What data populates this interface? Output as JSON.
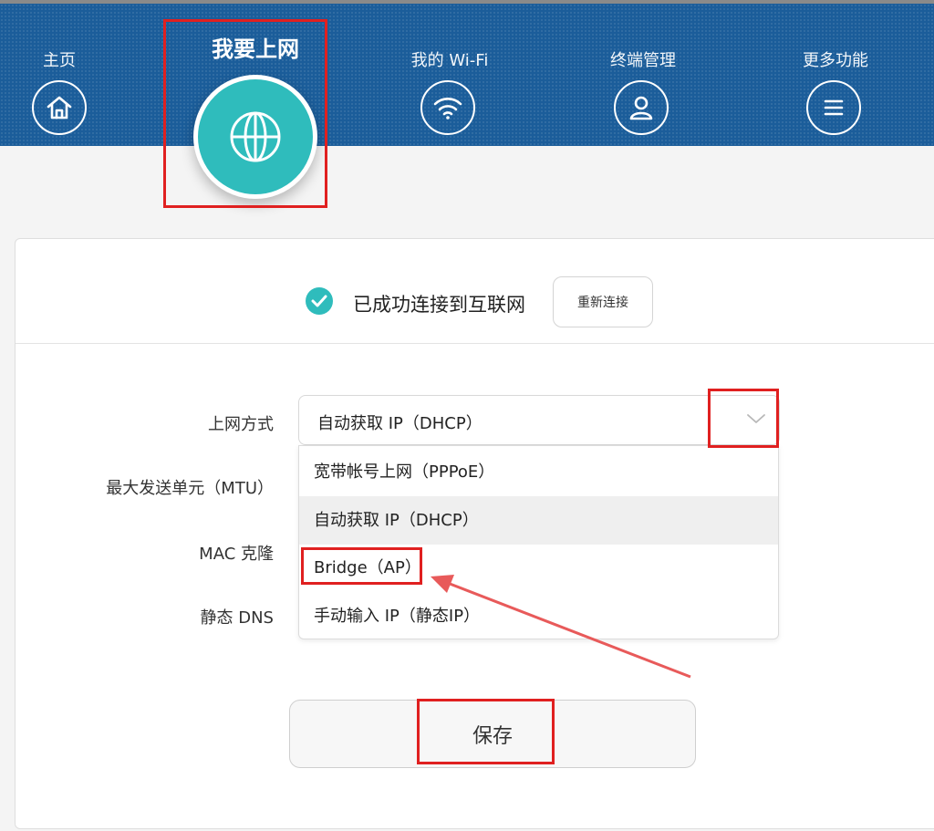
{
  "nav": {
    "home_label": "主页",
    "internet_label": "我要上网",
    "wifi_label": "我的 Wi-Fi",
    "devices_label": "终端管理",
    "more_label": "更多功能"
  },
  "status": {
    "text": "已成功连接到互联网",
    "reconnect_label": "重新连接"
  },
  "form": {
    "mode_label": "上网方式",
    "mtu_label": "最大发送单元（MTU）",
    "mac_label": "MAC 克隆",
    "dns_label": "静态 DNS",
    "mode_value": "自动获取 IP（DHCP）",
    "options": [
      "宽带帐号上网（PPPoE）",
      "自动获取 IP（DHCP）",
      "Bridge（AP）",
      "手动输入 IP（静态IP）"
    ],
    "selected_option": "自动获取 IP（DHCP）",
    "save_label": "保存"
  },
  "colors": {
    "nav_bg": "#1b5d9a",
    "accent": "#2fbcbc",
    "highlight": "#e02020"
  }
}
